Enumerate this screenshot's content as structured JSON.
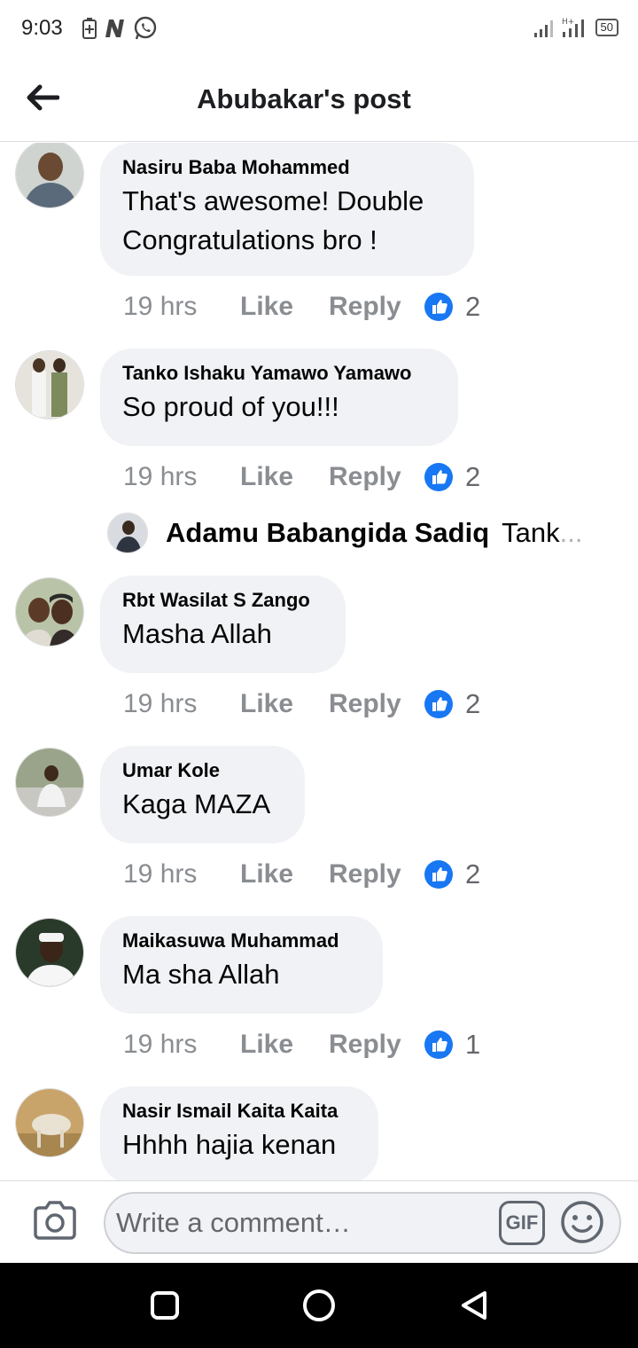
{
  "status_bar": {
    "time": "9:03",
    "battery": "50"
  },
  "header": {
    "title": "Abubakar's post"
  },
  "colors": {
    "like_blue": "#1877f2",
    "bubble_bg": "#f0f2f5",
    "meta_gray": "#8a8d91"
  },
  "comments": [
    {
      "author": "Nasiru Baba Mohammed",
      "text_lines": [
        "That's awesome! Double",
        "Congratulations bro !"
      ],
      "time": "19 hrs",
      "like_label": "Like",
      "reply_label": "Reply",
      "reactions": "2"
    },
    {
      "author": "Tanko Ishaku Yamawo Yamawo",
      "text_lines": [
        "So proud of you!!!"
      ],
      "time": "19 hrs",
      "like_label": "Like",
      "reply_label": "Reply",
      "reactions": "2"
    },
    {
      "author": "Rbt Wasilat S Zango",
      "text_lines": [
        "Masha Allah"
      ],
      "time": "19 hrs",
      "like_label": "Like",
      "reply_label": "Reply",
      "reactions": "2"
    },
    {
      "author": "Umar Kole",
      "text_lines": [
        "Kaga MAZA"
      ],
      "time": "19 hrs",
      "like_label": "Like",
      "reply_label": "Reply",
      "reactions": "2"
    },
    {
      "author": "Maikasuwa Muhammad",
      "text_lines": [
        "Ma sha Allah"
      ],
      "time": "19 hrs",
      "like_label": "Like",
      "reply_label": "Reply",
      "reactions": "1"
    },
    {
      "author": "Nasir Ismail Kaita Kaita",
      "text_lines": [
        "Hhhh hajia kenan"
      ]
    }
  ],
  "reply_preview": {
    "author": "Adamu Babangida Sadiq",
    "text": "Tank",
    "ellipsis": "..."
  },
  "composer": {
    "placeholder": "Write a comment…",
    "gif_label": "GIF"
  }
}
